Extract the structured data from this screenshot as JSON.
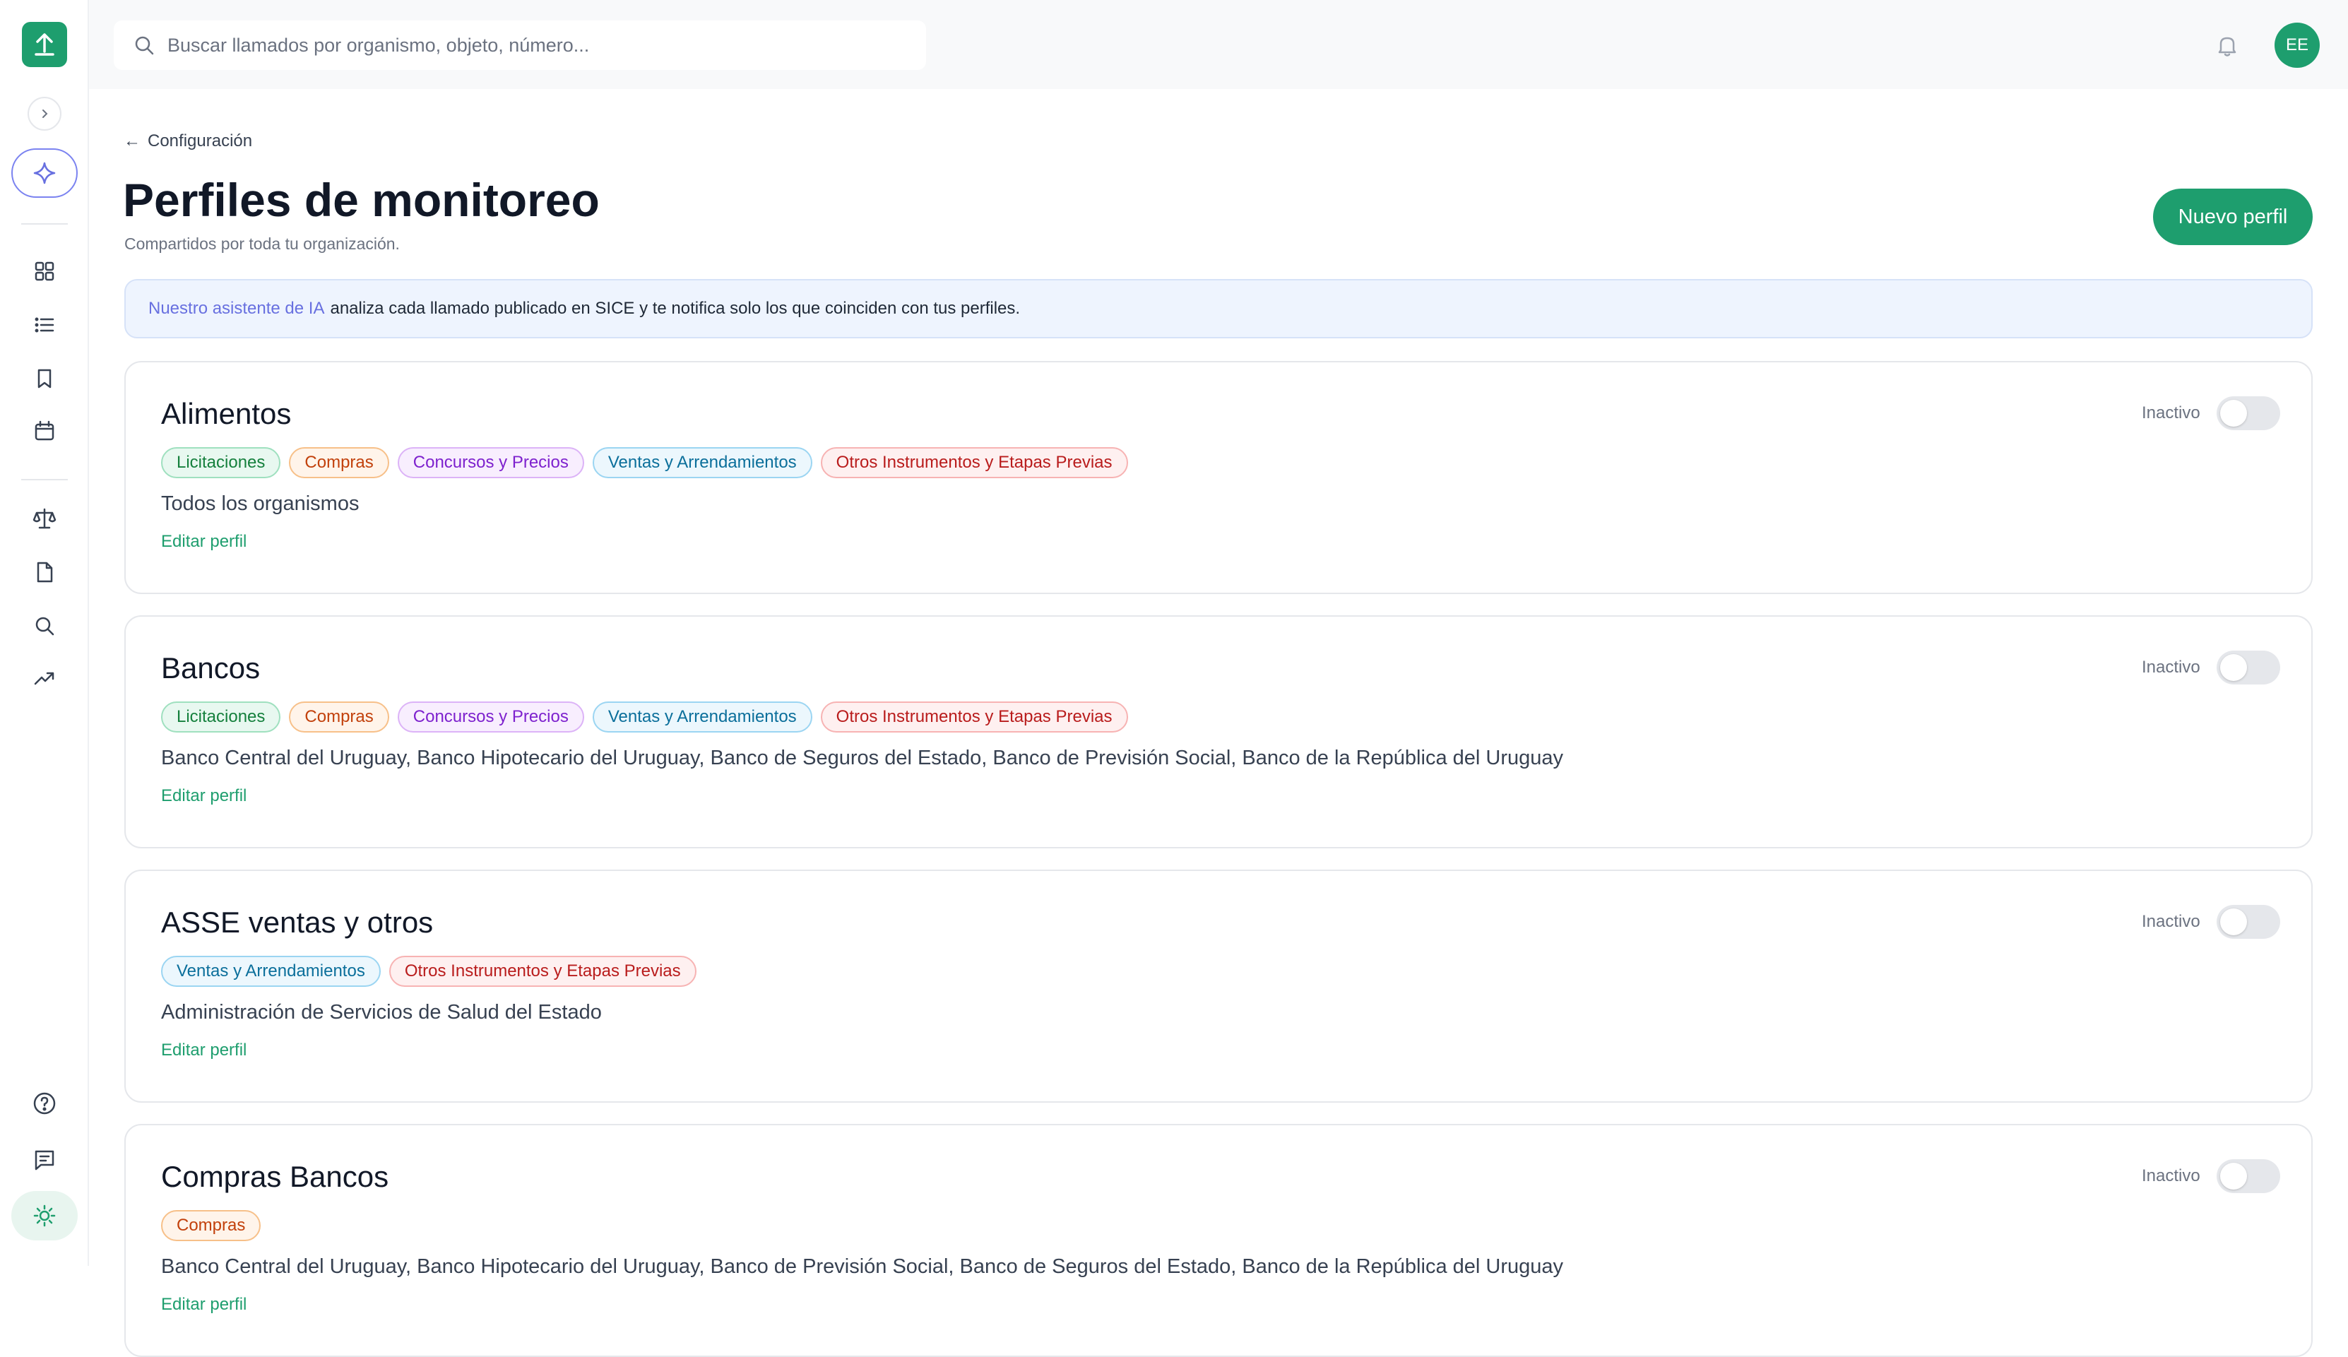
{
  "search": {
    "placeholder": "Buscar llamados por organismo, objeto, número..."
  },
  "user": {
    "initials": "EE"
  },
  "nav": {
    "icons": [
      "dashboard-icon",
      "list-icon",
      "bookmark-icon",
      "calendar-icon",
      "scale-icon",
      "document-icon",
      "search-icon",
      "trending-up-icon",
      "help-icon",
      "feedback-icon",
      "sun-icon"
    ]
  },
  "page": {
    "back_label": "Configuración",
    "title": "Perfiles de monitoreo",
    "subtitle": "Compartidos por toda tu organización.",
    "new_button": "Nuevo perfil"
  },
  "banner": {
    "highlight": "Nuestro asistente de IA",
    "text": "analiza cada llamado publicado en SICE y te notifica solo los que coinciden con tus perfiles."
  },
  "colors": {
    "accent": "#1e9e6e",
    "ai": "#6870e0"
  },
  "profiles": [
    {
      "name": "Alimentos",
      "status": "Inactivo",
      "tags": [
        "Licitaciones",
        "Compras",
        "Concursos y Precios",
        "Ventas y Arrendamientos",
        "Otros Instrumentos y Etapas Previas"
      ],
      "orgs": "Todos los organismos",
      "edit": "Editar perfil"
    },
    {
      "name": "Bancos",
      "status": "Inactivo",
      "tags": [
        "Licitaciones",
        "Compras",
        "Concursos y Precios",
        "Ventas y Arrendamientos",
        "Otros Instrumentos y Etapas Previas"
      ],
      "orgs": "Banco Central del Uruguay, Banco Hipotecario del Uruguay, Banco de Seguros del Estado, Banco de Previsión Social, Banco de la República del Uruguay",
      "edit": "Editar perfil"
    },
    {
      "name": "ASSE ventas y otros",
      "status": "Inactivo",
      "tags": [
        "Ventas y Arrendamientos",
        "Otros Instrumentos y Etapas Previas"
      ],
      "orgs": "Administración de Servicios de Salud del Estado",
      "edit": "Editar perfil"
    },
    {
      "name": "Compras Bancos",
      "status": "Inactivo",
      "tags": [
        "Compras"
      ],
      "orgs": "Banco Central del Uruguay, Banco Hipotecario del Uruguay, Banco de Previsión Social, Banco de Seguros del Estado, Banco de la República del Uruguay",
      "edit": "Editar perfil"
    }
  ]
}
